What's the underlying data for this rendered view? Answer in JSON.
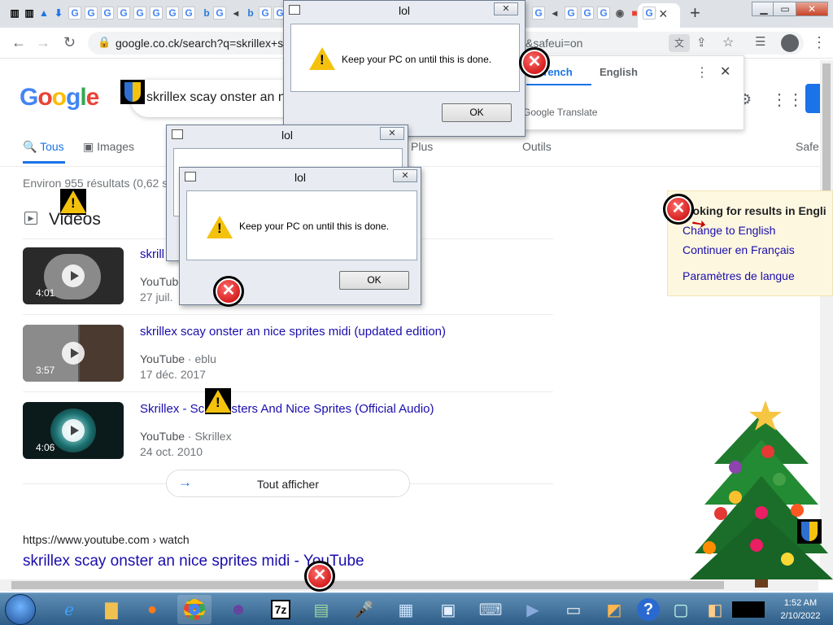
{
  "browser": {
    "url": "google.co.ck/search?q=skrillex+s",
    "url_tail": "&safeui=on",
    "tab_new": "+",
    "tab_close": "×"
  },
  "google": {
    "logo": "Google",
    "query": "skrillex scay onster an n",
    "tabs": [
      "Tous",
      "Images",
      "Plus",
      "Outils"
    ],
    "safe": "Safe",
    "stats": "Environ 955 résultats (0,62 s",
    "videos_heading": "Videos",
    "videos": [
      {
        "title": "skrill",
        "duration": "4:01",
        "source": "YouTube",
        "channel": "",
        "date": "27 juil."
      },
      {
        "title": "skrillex scay onster an nice sprites midi (updated edition)",
        "duration": "3:57",
        "source": "YouTube",
        "channel": "eblu",
        "date": "17 déc. 2017"
      },
      {
        "title": "Skrillex - Sc   Monsters And Nice Sprites (Official Audio)",
        "duration": "4:06",
        "source": "YouTube",
        "channel": "Skrillex",
        "date": "24 oct. 2010"
      }
    ],
    "show_all": "Tout afficher",
    "result_cite": "https://www.youtube.com › watch",
    "result_title": "skrillex scay onster an nice sprites midi - YouTube"
  },
  "translate": {
    "lang_from": "French",
    "lang_to": "English",
    "footer": "Google Translate"
  },
  "langbox": {
    "heading": "ooking for results in Engli",
    "links": [
      "Change to English",
      "Continuer en Français",
      "Paramètres de langue"
    ]
  },
  "dialogs": [
    {
      "title": "lol",
      "message": "Keep your PC on until this is done.",
      "ok": "OK",
      "close": "✕"
    },
    {
      "title": "lol",
      "message": "",
      "ok": "",
      "close": "✕"
    },
    {
      "title": "lol",
      "message": "Keep your PC on until this is done.",
      "ok": "OK",
      "close": "✕"
    }
  ],
  "taskbar": {
    "time": "1:52 AM",
    "date": "2/10/2022"
  },
  "colors": {
    "link": "#1a0dab",
    "google_blue": "#4285f4",
    "taskbar": "#2e5e88"
  }
}
